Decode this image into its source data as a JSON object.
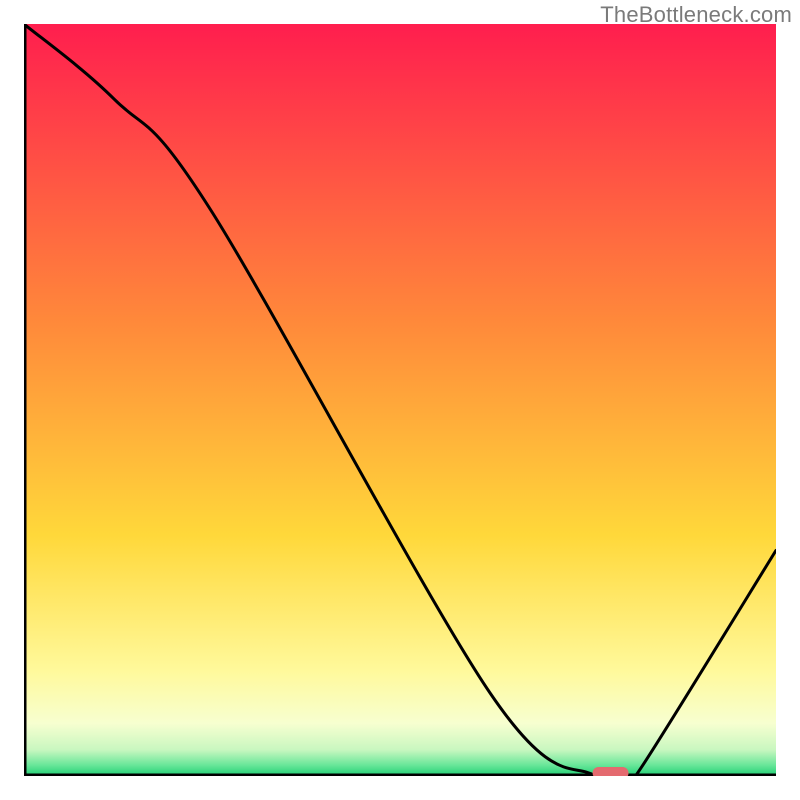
{
  "watermark": "TheBottleneck.com",
  "chart_data": {
    "type": "line",
    "title": "",
    "xlabel": "",
    "ylabel": "",
    "xlim": [
      0,
      100
    ],
    "ylim": [
      0,
      100
    ],
    "grid": false,
    "legend": false,
    "series": [
      {
        "name": "bottleneck-curve",
        "x": [
          0,
          12,
          25,
          62,
          76,
          80,
          82,
          100
        ],
        "values": [
          100,
          90,
          75,
          11,
          0,
          0,
          1,
          30
        ]
      }
    ],
    "markers": [
      {
        "name": "optimal-marker",
        "x": 78,
        "y": 0,
        "shape": "rounded-bar",
        "color": "#e46a6f"
      }
    ],
    "background_gradient": [
      {
        "stop": 0.0,
        "color": "#ff1e4e"
      },
      {
        "stop": 0.4,
        "color": "#ff8a3a"
      },
      {
        "stop": 0.68,
        "color": "#ffd83a"
      },
      {
        "stop": 0.86,
        "color": "#fff99b"
      },
      {
        "stop": 0.93,
        "color": "#f7ffd0"
      },
      {
        "stop": 0.965,
        "color": "#c9f7c0"
      },
      {
        "stop": 0.985,
        "color": "#6be79a"
      },
      {
        "stop": 1.0,
        "color": "#1fcf74"
      }
    ],
    "axes_color": "#000000"
  }
}
